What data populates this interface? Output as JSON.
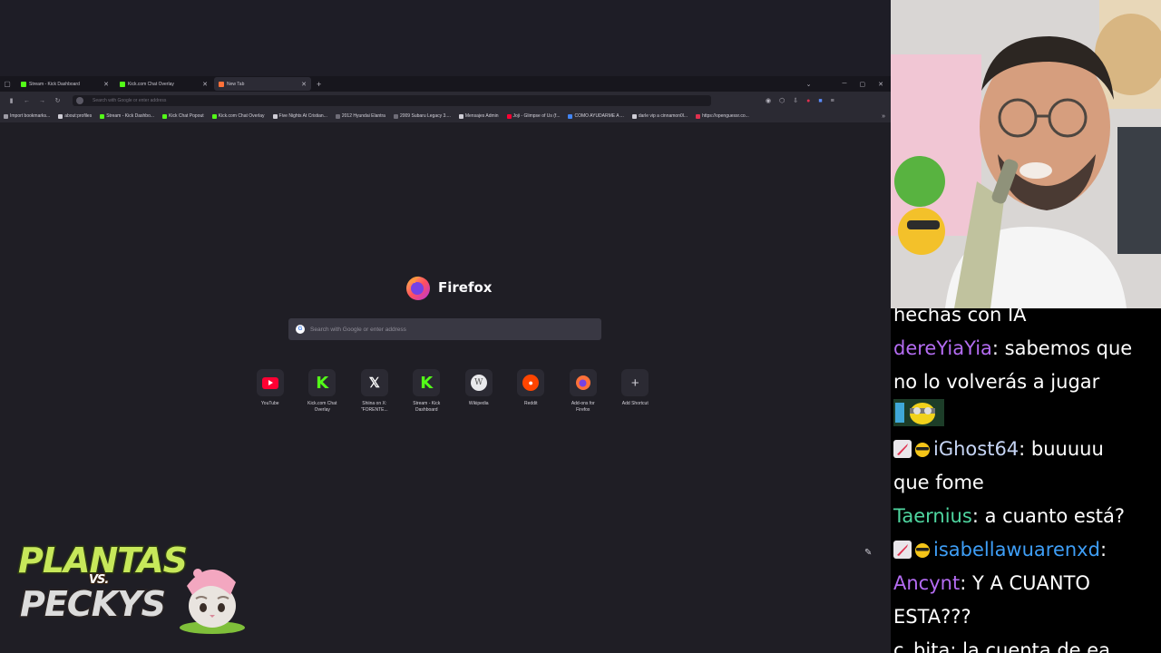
{
  "browser": {
    "tabs": [
      {
        "title": "Stream - Kick Dashboard",
        "favicon_color": "#53fc18",
        "active": false
      },
      {
        "title": "Kick.com Chat Overlay",
        "favicon_color": "#53fc18",
        "active": false
      },
      {
        "title": "New Tab",
        "favicon_color": "#ff7139",
        "active": true
      }
    ],
    "url_placeholder": "Search with Google or enter address",
    "bookmarks": [
      {
        "label": "Import bookmarks...",
        "color": "#9e9ca6"
      },
      {
        "label": "about:profiles",
        "color": "#cfcdd6"
      },
      {
        "label": "Stream - Kick Dashbo...",
        "color": "#53fc18"
      },
      {
        "label": "Kick Chat Popout",
        "color": "#53fc18"
      },
      {
        "label": "Kick.com Chat Overlay",
        "color": "#53fc18"
      },
      {
        "label": "Five Nights At Cristian...",
        "color": "#cfcdd6"
      },
      {
        "label": "2012 Hyundai Elantra",
        "color": "#6e6c77"
      },
      {
        "label": "2009 Subaru Legacy 3....",
        "color": "#6e6c77"
      },
      {
        "label": "Mensajes Admin",
        "color": "#cfcdd6"
      },
      {
        "label": "Joji - Glimpse of Us (f...",
        "color": "#ff0033"
      },
      {
        "label": "COMO AYUDARME A ...",
        "color": "#4285f4"
      },
      {
        "label": "darle vip a cinnamon0l...",
        "color": "#cfcdd6"
      },
      {
        "label": "https://openguessr.co...",
        "color": "#e0304e"
      }
    ]
  },
  "newtab": {
    "brand": "Firefox",
    "search_placeholder": "Search with Google or enter address",
    "shortcuts": [
      {
        "label": "YouTube",
        "icon": "youtube-icon"
      },
      {
        "label": "Kick.com Chat Overlay",
        "icon": "kick-icon"
      },
      {
        "label": "Shiina on X: \"FORENTE...",
        "icon": "x-icon"
      },
      {
        "label": "Stream - Kick Dashboard",
        "icon": "kick-icon"
      },
      {
        "label": "Wikipedia",
        "icon": "wikipedia-icon"
      },
      {
        "label": "Reddit",
        "icon": "reddit-icon"
      },
      {
        "label": "Add-ons for Firefox",
        "icon": "firefox-icon"
      },
      {
        "label": "Add Shortcut",
        "icon": "plus-icon"
      }
    ]
  },
  "overlay": {
    "logo_line1": "PLANTAS",
    "logo_vs": "VS.",
    "logo_line2": "PECKYS"
  },
  "chat": {
    "lines": [
      {
        "user": "",
        "user_color": "#ffffff",
        "text": "hechas con IA",
        "badges": []
      },
      {
        "user": "dereYiaYia",
        "user_color": "#b46cf2",
        "text": ": sabemos que",
        "badges": []
      },
      {
        "user": "",
        "user_color": "#ffffff",
        "text": "no lo volverás a jugar",
        "badges": []
      },
      {
        "user": "",
        "user_color": "#ffffff",
        "text": "",
        "badges": [
          "emote"
        ]
      },
      {
        "user": "iGhost64",
        "user_color": "#c6d5f5",
        "text": ": buuuuu",
        "badges": [
          "sword",
          "sunglasses"
        ]
      },
      {
        "user": "",
        "user_color": "#ffffff",
        "text": "que fome",
        "badges": []
      },
      {
        "user": "Taernius",
        "user_color": "#4fd6a0",
        "text": ": a cuanto está?",
        "badges": []
      },
      {
        "user": "isabellawuarenxd",
        "user_color": "#3e9ef6",
        "text": ":",
        "badges": [
          "sword",
          "sunglasses"
        ]
      },
      {
        "user": "Ancynt",
        "user_color": "#b46cf2",
        "text": ": Y A CUANTO",
        "badges": []
      },
      {
        "user": "",
        "user_color": "#ffffff",
        "text": "ESTA???",
        "badges": []
      },
      {
        "user": "c_bita",
        "user_color": "#ffffff",
        "text": ": la cuenta de ea",
        "badges": []
      }
    ]
  }
}
